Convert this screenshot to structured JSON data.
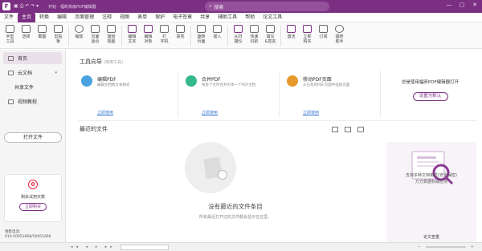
{
  "titlebar": {
    "logo": "F",
    "title": "开始 · 福昕高级PDF编辑器",
    "search_placeholder": "搜索",
    "minimize": "—",
    "maximize": "▢",
    "close": "✕"
  },
  "menu": [
    "文件",
    "主页",
    "转换",
    "编辑",
    "页面管理",
    "注释",
    "视图",
    "表单",
    "保护",
    "电子签章",
    "共享",
    "辅助工具",
    "帮助",
    "论文工具"
  ],
  "ribbon": [
    {
      "label": "手型\n工具"
    },
    {
      "label": "选择"
    },
    {
      "label": "截图"
    },
    {
      "label": "剪贴\n板"
    },
    {
      "label": "缩放"
    },
    {
      "label": "页面\n适合"
    },
    {
      "label": "旋转\n视图"
    },
    {
      "label": "编辑\n文本"
    },
    {
      "label": "编辑\n对象"
    },
    {
      "label": "打\n字机"
    },
    {
      "label": "高亮"
    },
    {
      "label": "旋转\n页面"
    },
    {
      "label": "插入"
    },
    {
      "label": "从扫\n描仪"
    },
    {
      "label": "快速\n识别"
    },
    {
      "label": "填写\n&签名"
    },
    {
      "label": "激活"
    },
    {
      "label": "立即\n购买"
    },
    {
      "label": "订阅"
    },
    {
      "label": "福昕\n助手"
    }
  ],
  "sidebar": {
    "items": [
      {
        "label": "首页"
      },
      {
        "label": "云文档"
      },
      {
        "label": "共享文件"
      },
      {
        "label": "视频教程"
      }
    ],
    "open_file": "打开文件",
    "trial_days": "0",
    "trial_label": "剩余试用天数",
    "buy_now": "立即购买",
    "phone_label": "销售电话:",
    "phone_number": "010-50951668/50951666"
  },
  "main": {
    "tools_title": "工具向导",
    "tools_sub": "(常用工具)",
    "tools": [
      {
        "name": "编辑PDF",
        "desc": "编辑文档和文本格式",
        "link": "立即使用",
        "color": "#4aa3e0"
      },
      {
        "name": "合并PDF",
        "desc": "将多个文件合并为单一个PDF文档",
        "link": "立即使用",
        "color": "#35b88a"
      },
      {
        "name": "移动PDF页面",
        "desc": "从已有的PDF页面中选择页面",
        "link": "立即使用",
        "color": "#e69a2b"
      }
    ],
    "default_text": "总是使用福昕PDF编辑器打开",
    "default_btn": "设置为默认",
    "recent_title": "最近的文件",
    "empty_title": "没有最近的文件条目",
    "empty_sub": "所有最近打开过的文件都会显示在这里。",
    "promo_caption": "论文查重",
    "promo_text_1": "支持多种文档格式(安全保密)",
    "promo_text_2": "万方数据权威检测"
  }
}
